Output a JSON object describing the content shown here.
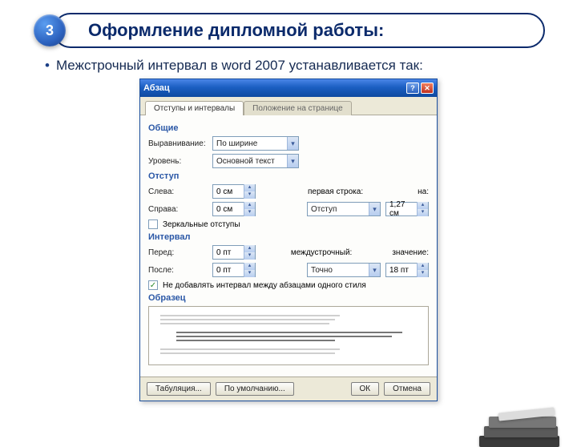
{
  "slide": {
    "badge": "3",
    "title": "Оформление дипломной работы:",
    "bullet": "Межстрочный интервал в word 2007 устанавливается так:"
  },
  "dialog": {
    "title": "Абзац",
    "winbuttons": {
      "help": "?",
      "close": "✕"
    },
    "tabs": {
      "active": "Отступы и интервалы",
      "inactive": "Положение на странице"
    },
    "sections": {
      "general": "Общие",
      "indent": "Отступ",
      "spacing": "Интервал",
      "preview": "Образец"
    },
    "general": {
      "alignment_label": "Выравнивание:",
      "alignment_value": "По ширине",
      "level_label": "Уровень:",
      "level_value": "Основной текст"
    },
    "indent": {
      "left_label": "Слева:",
      "left_value": "0 см",
      "right_label": "Справа:",
      "right_value": "0 см",
      "first_label": "первая строка:",
      "first_value": "Отступ",
      "on_label": "на:",
      "on_value": "1,27 см",
      "mirror": "Зеркальные отступы"
    },
    "spacing": {
      "before_label": "Перед:",
      "before_value": "0 пт",
      "after_label": "После:",
      "after_value": "0 пт",
      "line_label": "междустрочный:",
      "line_value": "Точно",
      "val_label": "значение:",
      "val_value": "18 пт",
      "nospace": "Не добавлять интервал между абзацами одного стиля"
    },
    "buttons": {
      "tabstops": "Табуляция...",
      "defaults": "По умолчанию...",
      "ok": "ОК",
      "cancel": "Отмена"
    }
  }
}
